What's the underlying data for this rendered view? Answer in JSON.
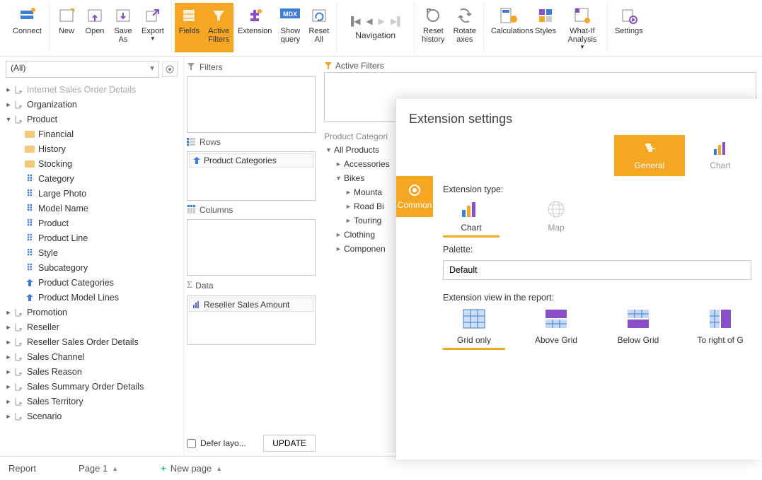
{
  "ribbon": {
    "connect": "Connect",
    "new": "New",
    "open": "Open",
    "save_as": "Save\nAs",
    "export": "Export",
    "fields": "Fields",
    "active_filters": "Active\nFilters",
    "extension": "Extension",
    "show_query": "Show\nquery",
    "reset_all": "Reset\nAll",
    "navigation": "Navigation",
    "reset_history": "Reset\nhistory",
    "rotate_axes": "Rotate\naxes",
    "calculations": "Calculations",
    "styles": "Styles",
    "what_if": "What-If\nAnalysis",
    "settings": "Settings"
  },
  "left": {
    "all": "(All)",
    "tree": [
      {
        "d": 0,
        "t": "hier",
        "a": "►",
        "label": "Internet Sales Order Details",
        "dim": true
      },
      {
        "d": 0,
        "t": "hier",
        "a": "►",
        "label": "Organization"
      },
      {
        "d": 0,
        "t": "hier",
        "a": "▼",
        "label": "Product"
      },
      {
        "d": 1,
        "t": "folder",
        "a": "",
        "label": "Financial"
      },
      {
        "d": 1,
        "t": "folder",
        "a": "",
        "label": "History"
      },
      {
        "d": 1,
        "t": "folder",
        "a": "",
        "label": "Stocking"
      },
      {
        "d": 1,
        "t": "fld",
        "a": "",
        "label": "Category"
      },
      {
        "d": 1,
        "t": "fld",
        "a": "",
        "label": "Large Photo"
      },
      {
        "d": 1,
        "t": "fld",
        "a": "",
        "label": "Model Name"
      },
      {
        "d": 1,
        "t": "fld",
        "a": "",
        "label": "Product"
      },
      {
        "d": 1,
        "t": "fld",
        "a": "",
        "label": "Product Line"
      },
      {
        "d": 1,
        "t": "fld",
        "a": "",
        "label": "Style"
      },
      {
        "d": 1,
        "t": "fld",
        "a": "",
        "label": "Subcategory"
      },
      {
        "d": 1,
        "t": "h2",
        "a": "",
        "label": "Product Categories"
      },
      {
        "d": 1,
        "t": "h2",
        "a": "",
        "label": "Product Model Lines"
      },
      {
        "d": 0,
        "t": "hier",
        "a": "►",
        "label": "Promotion"
      },
      {
        "d": 0,
        "t": "hier",
        "a": "►",
        "label": "Reseller"
      },
      {
        "d": 0,
        "t": "hier",
        "a": "►",
        "label": "Reseller Sales Order Details"
      },
      {
        "d": 0,
        "t": "hier",
        "a": "►",
        "label": "Sales Channel"
      },
      {
        "d": 0,
        "t": "hier",
        "a": "►",
        "label": "Sales Reason"
      },
      {
        "d": 0,
        "t": "hier",
        "a": "►",
        "label": "Sales Summary Order Details"
      },
      {
        "d": 0,
        "t": "hier",
        "a": "►",
        "label": "Sales Territory"
      },
      {
        "d": 0,
        "t": "hier",
        "a": "►",
        "label": "Scenario"
      }
    ]
  },
  "mid": {
    "filters": "Filters",
    "rows": "Rows",
    "rows_chip": "Product Categories",
    "columns": "Columns",
    "data": "Data",
    "data_chip": "Reseller Sales Amount",
    "defer": "Defer layo...",
    "update": "UPDATE"
  },
  "right": {
    "active_filters": "Active Filters",
    "pc_hdr": "Product Categori",
    "dtree": [
      {
        "d": 0,
        "a": "▼",
        "label": "All Products"
      },
      {
        "d": 1,
        "a": "►",
        "label": "Accessories"
      },
      {
        "d": 1,
        "a": "▼",
        "label": "Bikes"
      },
      {
        "d": 2,
        "a": "►",
        "label": "Mounta"
      },
      {
        "d": 2,
        "a": "►",
        "label": "Road Bi"
      },
      {
        "d": 2,
        "a": "►",
        "label": "Touring"
      },
      {
        "d": 1,
        "a": "►",
        "label": "Clothing"
      },
      {
        "d": 1,
        "a": "►",
        "label": "Componen"
      }
    ]
  },
  "ext": {
    "title": "Extension settings",
    "tab_general": "General",
    "tab_chart": "Chart",
    "side_common": "Common",
    "type_label": "Extension type:",
    "type_chart": "Chart",
    "type_map": "Map",
    "palette_label": "Palette:",
    "palette_value": "Default",
    "view_label": "Extension view in the report:",
    "view_grid": "Grid only",
    "view_above": "Above Grid",
    "view_below": "Below Grid",
    "view_right": "To right of G"
  },
  "footer": {
    "report": "Report",
    "page": "Page 1",
    "new_page": "New page"
  }
}
